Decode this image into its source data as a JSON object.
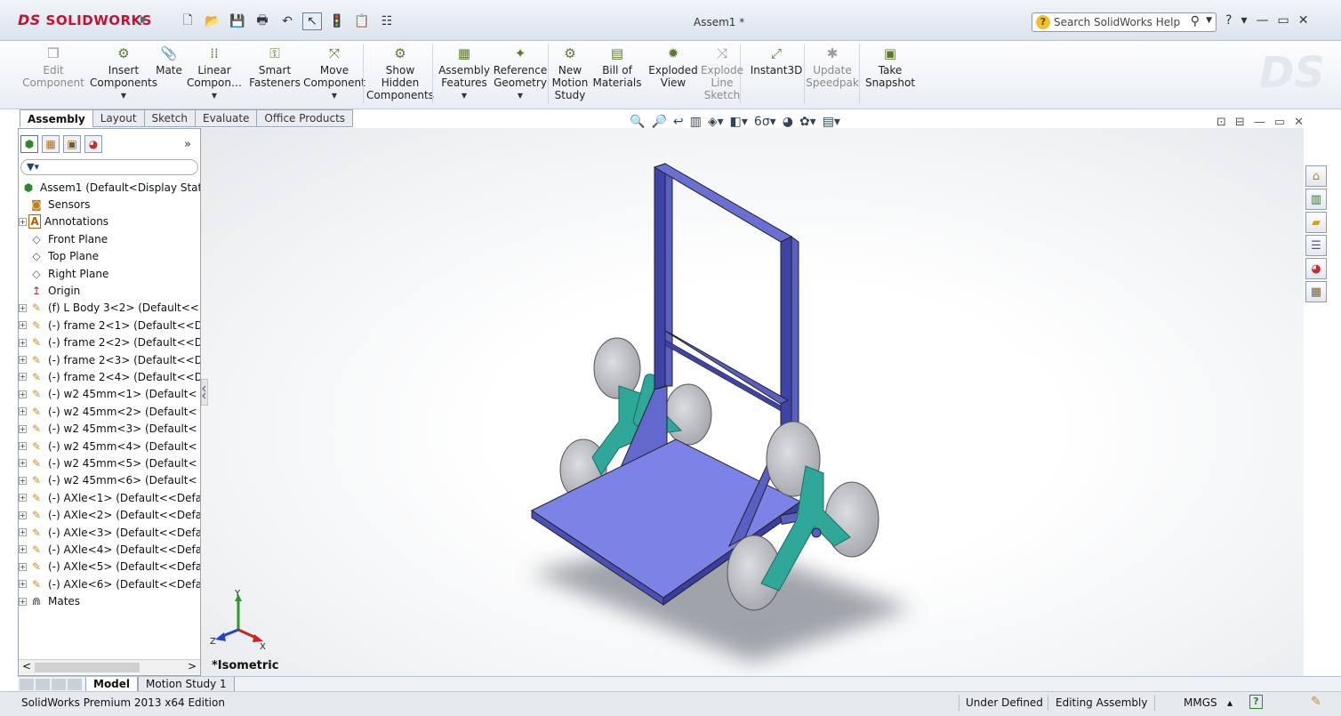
{
  "app": {
    "logo_text": "SOLIDWORKS",
    "logo_prefix": "DS",
    "document_title": "Assem1 *",
    "help_search_placeholder": "Search SolidWorks Help",
    "help_glyph": "?",
    "window_controls": [
      "?",
      "▾",
      "—",
      "▭",
      "✕"
    ]
  },
  "ribbon": {
    "commands": [
      {
        "label": "Edit\nComponent",
        "icon": "edit-component-icon",
        "disabled": true
      },
      {
        "label": "Insert\nComponents",
        "icon": "insert-components-icon",
        "arrow": true
      },
      {
        "label": "Mate",
        "icon": "mate-icon"
      },
      {
        "label": "Linear\nCompon…",
        "icon": "linear-pattern-icon",
        "arrow": true
      },
      {
        "label": "Smart\nFasteners",
        "icon": "smart-fasteners-icon"
      },
      {
        "label": "Move\nComponent",
        "icon": "move-component-icon",
        "arrow": true
      },
      {
        "label": "Show\nHidden\nComponents",
        "icon": "show-hidden-icon"
      },
      {
        "label": "Assembly\nFeatures",
        "icon": "assembly-features-icon",
        "arrow": true
      },
      {
        "label": "Reference\nGeometry",
        "icon": "reference-geometry-icon",
        "arrow": true
      },
      {
        "label": "New\nMotion\nStudy",
        "icon": "motion-study-icon"
      },
      {
        "label": "Bill of\nMaterials",
        "icon": "bom-icon"
      },
      {
        "label": "Exploded\nView",
        "icon": "exploded-view-icon"
      },
      {
        "label": "Explode\nLine\nSketch",
        "icon": "explode-line-icon",
        "disabled": true
      },
      {
        "label": "Instant3D",
        "icon": "instant3d-icon"
      },
      {
        "label": "Update\nSpeedpak",
        "icon": "speedpak-icon",
        "disabled": true
      },
      {
        "label": "Take\nSnapshot",
        "icon": "snapshot-icon"
      }
    ]
  },
  "command_tabs": [
    "Assembly",
    "Layout",
    "Sketch",
    "Evaluate",
    "Office Products"
  ],
  "feature_tree": {
    "more_glyph": "»",
    "items": [
      {
        "label": "Assem1  (Default<Display State",
        "expand": "",
        "icon": "assembly-icon"
      },
      {
        "label": "Sensors",
        "expand": "none",
        "icon": "sensor-icon"
      },
      {
        "label": "Annotations",
        "expand": "+",
        "icon": "annotation-icon"
      },
      {
        "label": "Front Plane",
        "expand": "none",
        "icon": "plane-icon"
      },
      {
        "label": "Top Plane",
        "expand": "none",
        "icon": "plane-icon"
      },
      {
        "label": "Right Plane",
        "expand": "none",
        "icon": "plane-icon"
      },
      {
        "label": "Origin",
        "expand": "none",
        "icon": "origin-icon"
      },
      {
        "label": "(f) L Body 3<2>  (Default<<",
        "expand": "+",
        "icon": "part-icon"
      },
      {
        "label": "(-) frame 2<1>  (Default<<D",
        "expand": "+",
        "icon": "part-icon"
      },
      {
        "label": "(-) frame 2<2>  (Default<<D",
        "expand": "+",
        "icon": "part-icon"
      },
      {
        "label": "(-) frame 2<3>  (Default<<D",
        "expand": "+",
        "icon": "part-icon"
      },
      {
        "label": "(-) frame 2<4>  (Default<<D",
        "expand": "+",
        "icon": "part-icon"
      },
      {
        "label": "(-) w2 45mm<1>  (Default<",
        "expand": "+",
        "icon": "part-icon"
      },
      {
        "label": "(-) w2 45mm<2>  (Default<",
        "expand": "+",
        "icon": "part-icon"
      },
      {
        "label": "(-) w2 45mm<3>  (Default<",
        "expand": "+",
        "icon": "part-icon"
      },
      {
        "label": "(-) w2 45mm<4>  (Default<",
        "expand": "+",
        "icon": "part-icon"
      },
      {
        "label": "(-) w2 45mm<5>  (Default<",
        "expand": "+",
        "icon": "part-icon"
      },
      {
        "label": "(-) w2 45mm<6>  (Default<",
        "expand": "+",
        "icon": "part-icon"
      },
      {
        "label": "(-) AXle<1>  (Default<<Defa",
        "expand": "+",
        "icon": "part-icon"
      },
      {
        "label": "(-) AXle<2>  (Default<<Defa",
        "expand": "+",
        "icon": "part-icon"
      },
      {
        "label": "(-) AXle<3>  (Default<<Defa",
        "expand": "+",
        "icon": "part-icon"
      },
      {
        "label": "(-) AXle<4>  (Default<<Defa",
        "expand": "+",
        "icon": "part-icon"
      },
      {
        "label": "(-) AXle<5>  (Default<<Defa",
        "expand": "+",
        "icon": "part-icon"
      },
      {
        "label": "(-) AXle<6>  (Default<<Defa",
        "expand": "+",
        "icon": "part-icon"
      },
      {
        "label": "Mates",
        "expand": "+",
        "icon": "mates-icon"
      }
    ]
  },
  "viewport": {
    "view_label": "*Isometric",
    "triad": {
      "x": "X",
      "y": "Y",
      "z": "Z"
    },
    "colors": {
      "frame": "#5a5fc4",
      "plate": "#7d82e6",
      "bracket": "#2fa89a",
      "wheel": "#c5c7cc",
      "shadow": "#444a55"
    }
  },
  "bottom_tabs": [
    "Model",
    "Motion Study 1"
  ],
  "status": {
    "edition": "SolidWorks Premium 2013 x64 Edition",
    "state": "Under Defined",
    "mode": "Editing Assembly",
    "units": "MMGS",
    "units_arrow": "▴",
    "help_btn": "?"
  }
}
